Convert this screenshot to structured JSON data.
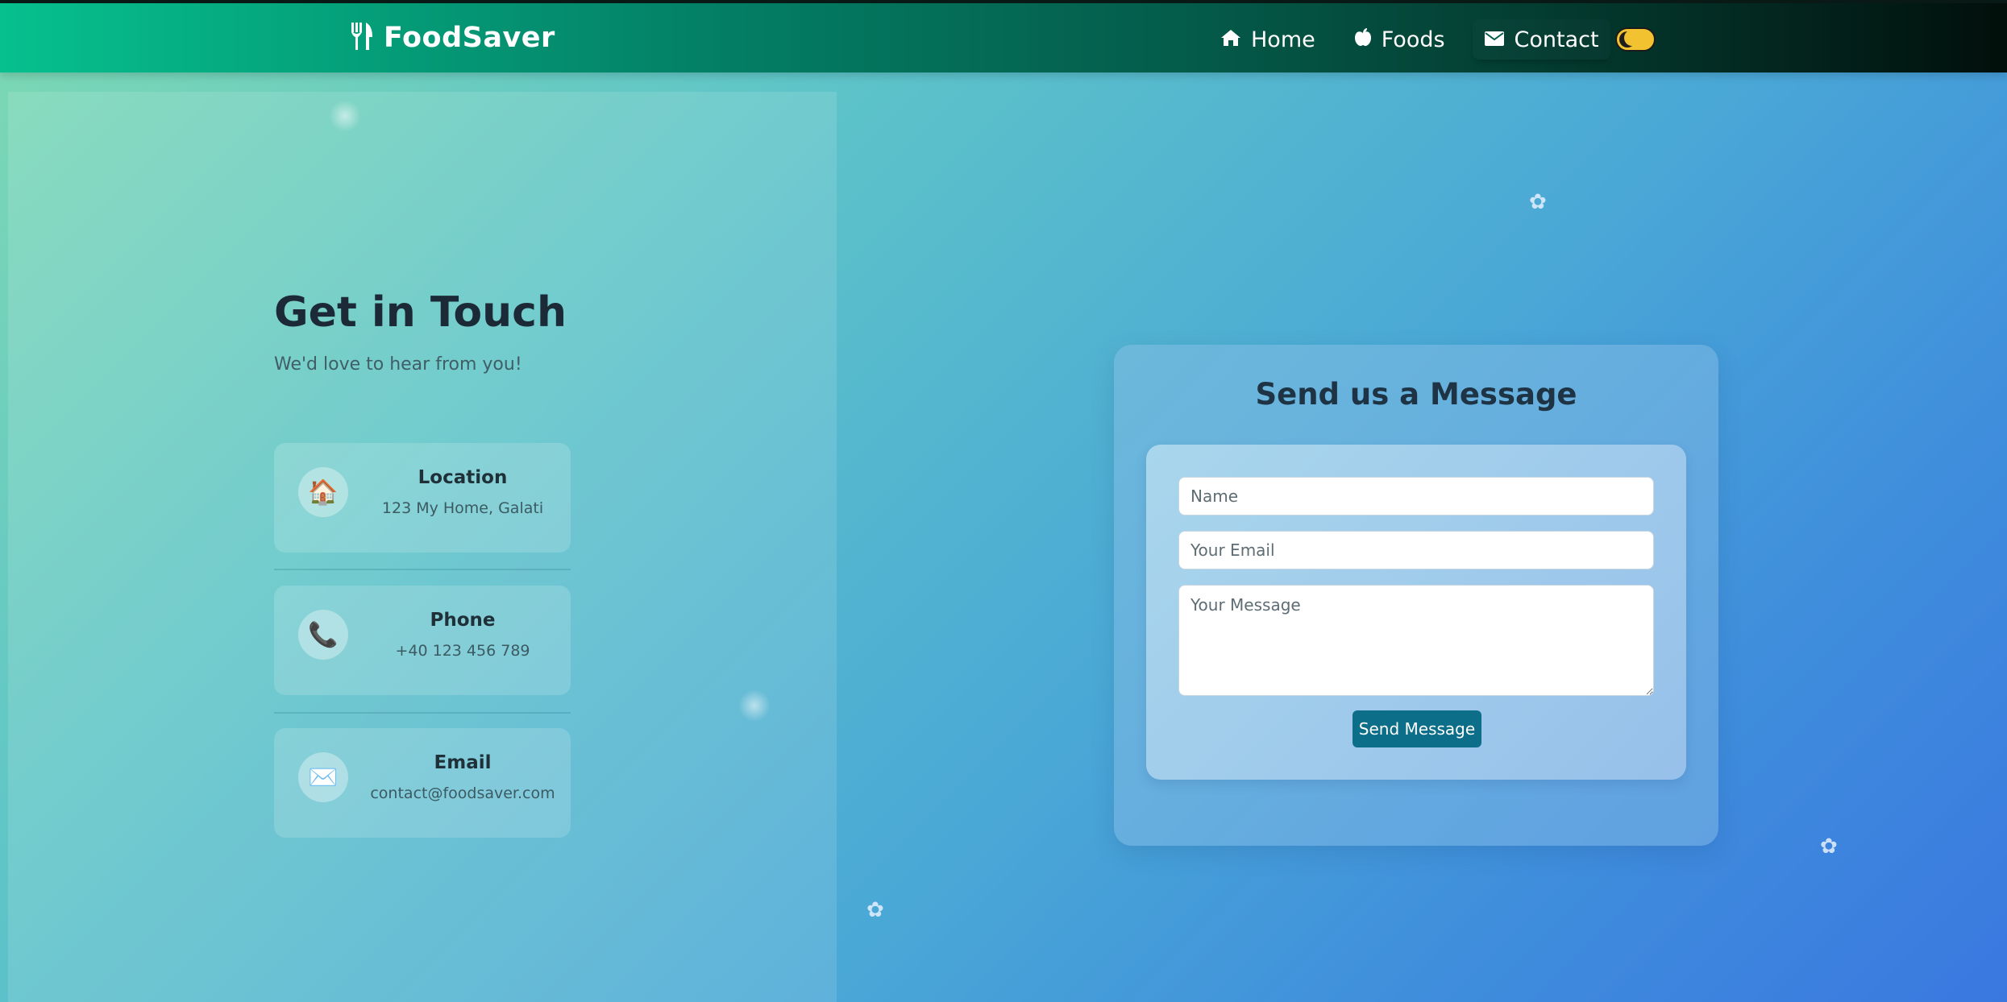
{
  "navbar": {
    "brand": "FoodSaver",
    "links": [
      {
        "label": "Home",
        "icon": "home-icon"
      },
      {
        "label": "Foods",
        "icon": "apple-icon"
      },
      {
        "label": "Contact",
        "icon": "envelope-icon"
      }
    ],
    "active": "Contact",
    "theme_toggle": "dark-mode-toggle"
  },
  "contact": {
    "title": "Get in Touch",
    "subtitle": "We'd love to hear from you!",
    "items": [
      {
        "label": "Location",
        "value": "123 My Home, Galati",
        "icon": "house-icon"
      },
      {
        "label": "Phone",
        "value": "+40 123 456 789",
        "icon": "phone-icon"
      },
      {
        "label": "Email",
        "value": "contact@foodsaver.com",
        "icon": "envelope-icon"
      }
    ]
  },
  "form": {
    "title": "Send us a Message",
    "name_placeholder": "Name",
    "email_placeholder": "Your Email",
    "message_placeholder": "Your Message",
    "submit_label": "Send Message"
  },
  "colors": {
    "accent": "#0c6e88",
    "nav_start": "#06c08e",
    "nav_end": "#020f0b",
    "toggle": "#f2c230"
  }
}
